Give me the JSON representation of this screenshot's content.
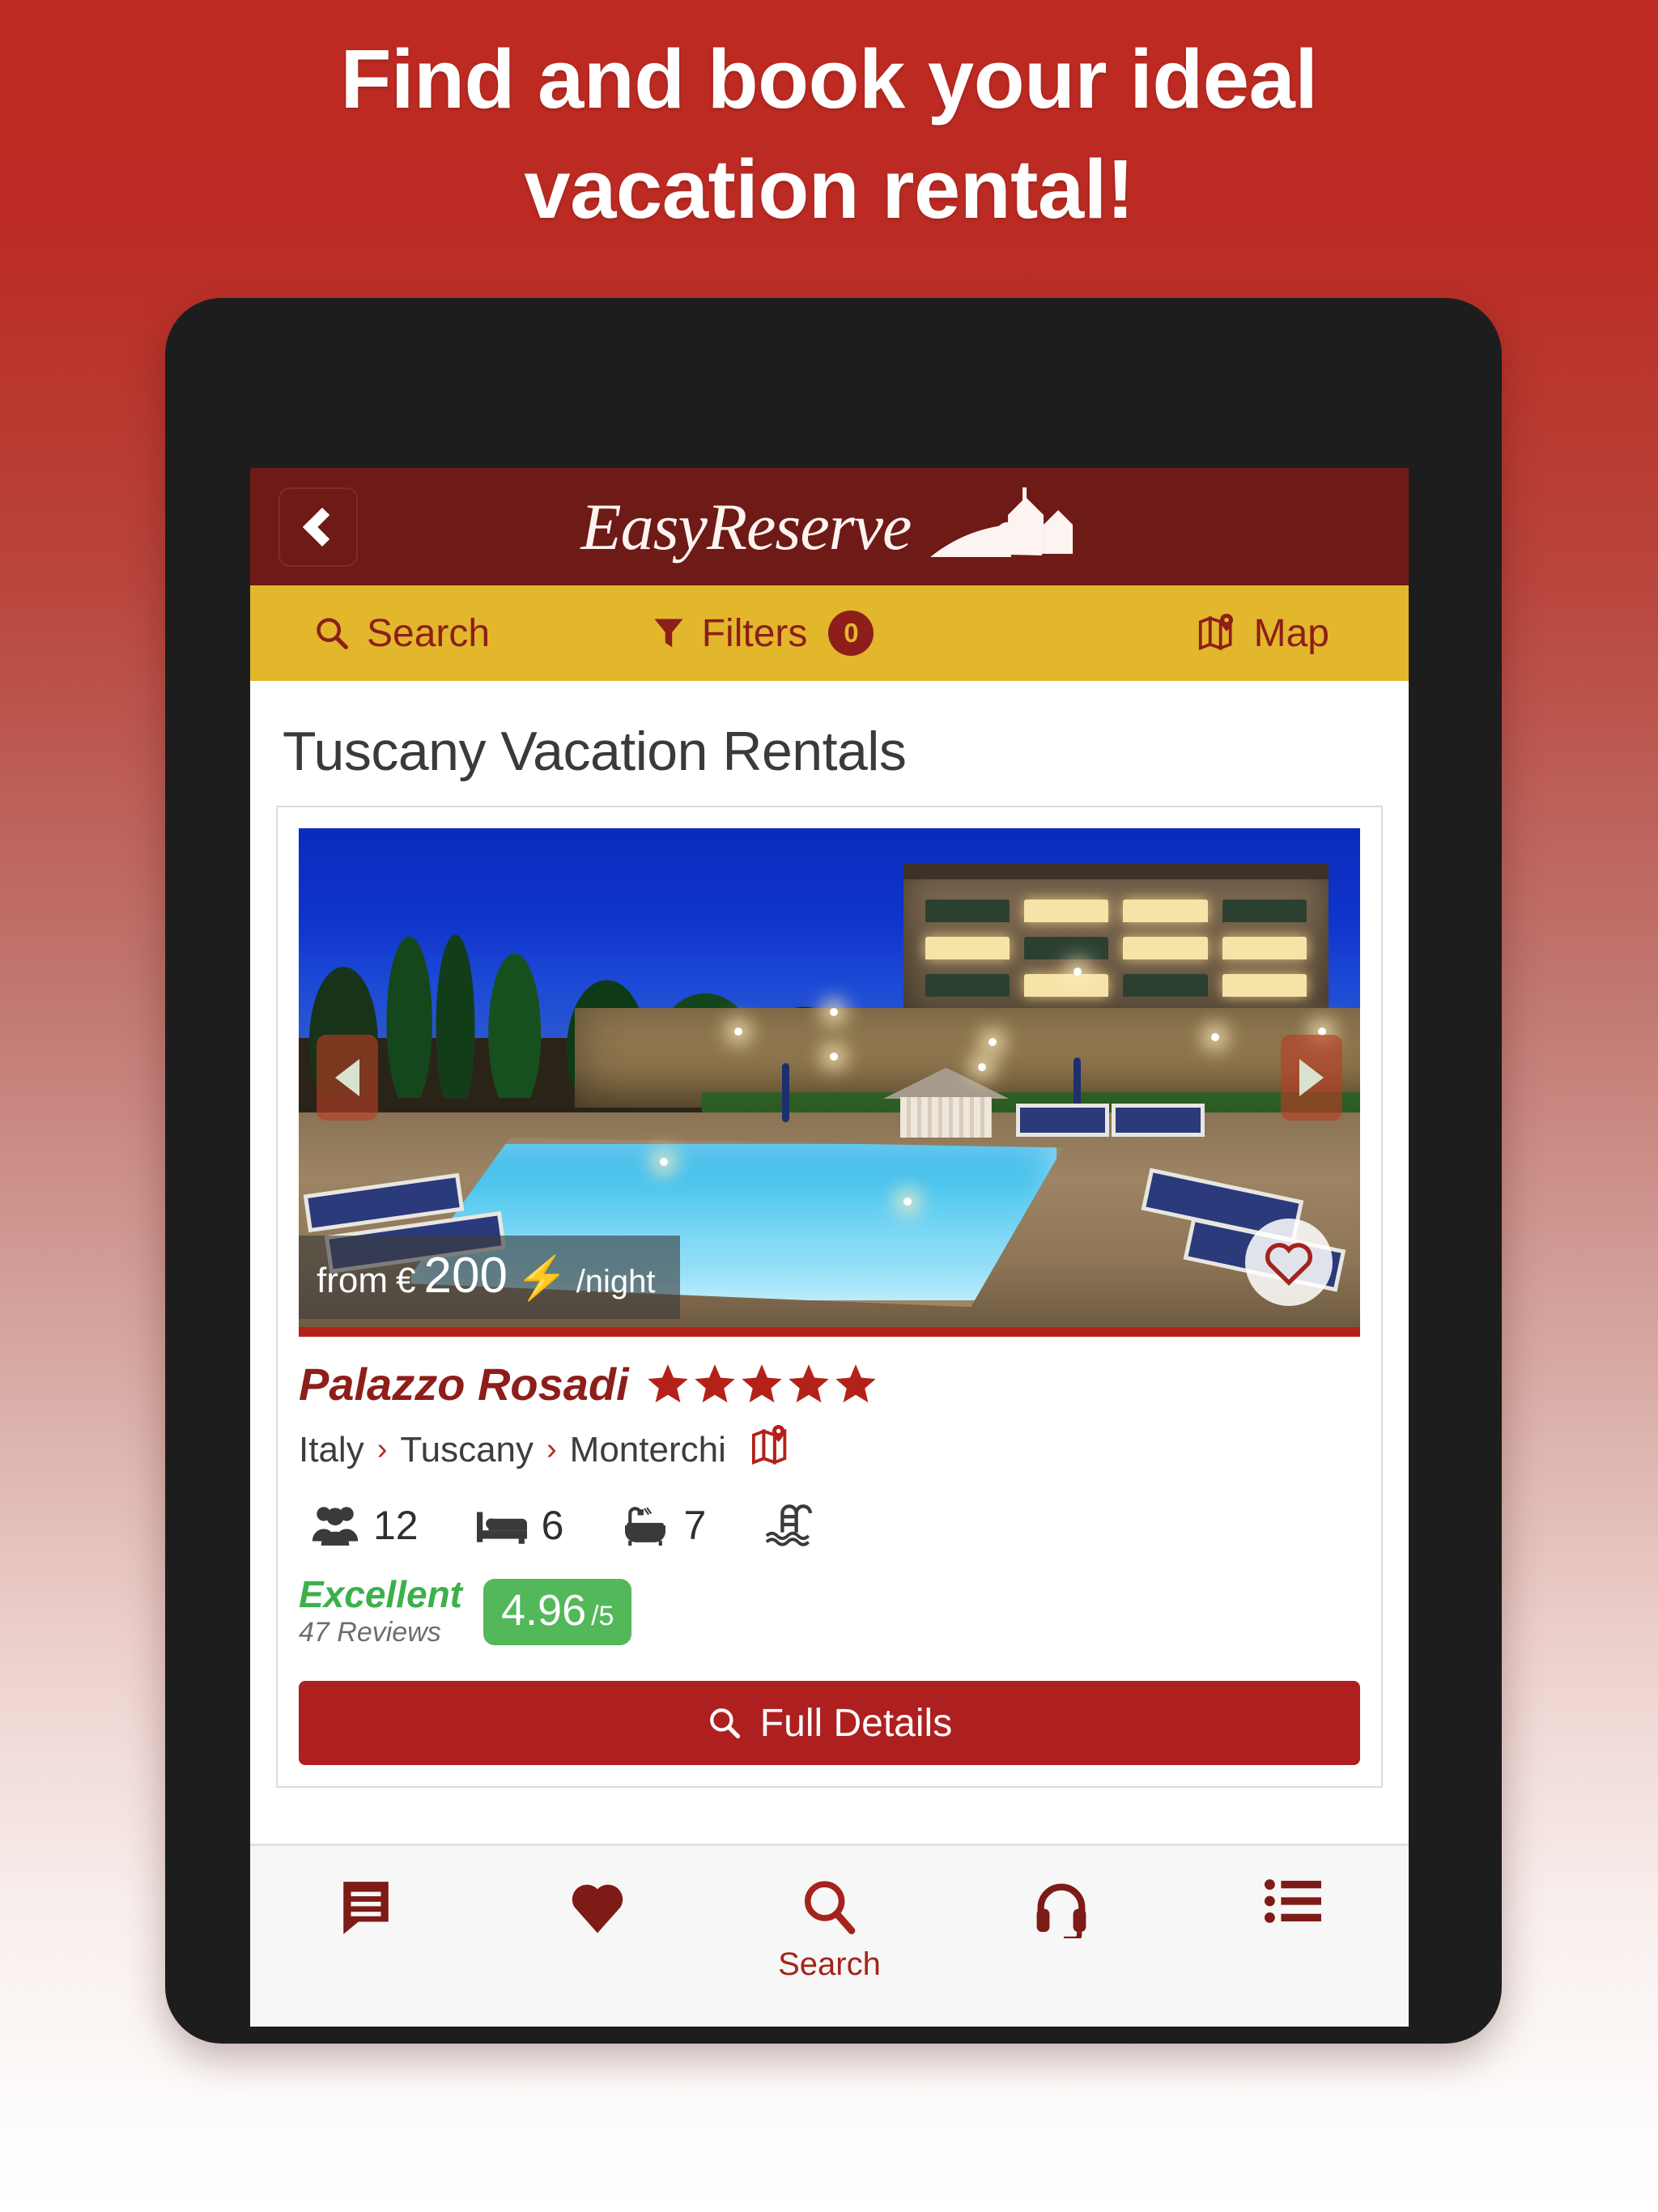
{
  "promo": {
    "line1": "Find and book your ideal",
    "line2": "vacation rental!"
  },
  "colors": {
    "background_top": "#bd2a22",
    "background_bottom": "#ffffff",
    "header_maroon": "#6e1a16",
    "toolbar_yellow": "#e2b72c",
    "accent_red": "#ae2020",
    "rating_green": "#52b85a",
    "brand_text": "#8d1e19"
  },
  "app_header": {
    "back_icon": "chevron-left-icon",
    "brand_name": "EasyReserve",
    "brand_mark_icon": "villa-hill-logo-icon"
  },
  "toolbar": {
    "search_label": "Search",
    "search_icon": "search-icon",
    "filters_label": "Filters",
    "filters_icon": "funnel-icon",
    "filters_count": "0",
    "map_label": "Map",
    "map_icon": "map-pin-icon"
  },
  "page": {
    "title": "Tuscany Vacation Rentals"
  },
  "listing": {
    "photo": {
      "prev_icon": "chevron-left-arrow-icon",
      "next_icon": "chevron-right-arrow-icon",
      "favorite_icon": "heart-outline-icon",
      "alt": "Illuminated stone villa with swimming pool at night"
    },
    "price": {
      "prefix": "from",
      "currency": "€",
      "amount": "200",
      "bolt_icon": "lightning-bolt-icon",
      "suffix": "/night"
    },
    "name": "Palazzo Rosadi",
    "star_rating": 5,
    "star_icon": "star-icon",
    "breadcrumb": [
      "Italy",
      "Tuscany",
      "Monterchi"
    ],
    "breadcrumb_separator": "›",
    "breadcrumb_map_icon": "map-pin-icon",
    "amenities": [
      {
        "icon": "guests-icon",
        "value": "12"
      },
      {
        "icon": "bed-icon",
        "value": "6"
      },
      {
        "icon": "bathtub-icon",
        "value": "7"
      },
      {
        "icon": "pool-icon",
        "value": ""
      }
    ],
    "review": {
      "word": "Excellent",
      "count_label": "47 Reviews",
      "score": "4.96",
      "score_denominator": "/5"
    },
    "cta": {
      "label": "Full Details",
      "icon": "search-icon"
    }
  },
  "bottom_nav": [
    {
      "icon": "chat-icon",
      "label": ""
    },
    {
      "icon": "heart-filled-icon",
      "label": ""
    },
    {
      "icon": "search-icon",
      "label": "Search"
    },
    {
      "icon": "headset-icon",
      "label": ""
    },
    {
      "icon": "list-icon",
      "label": ""
    }
  ]
}
